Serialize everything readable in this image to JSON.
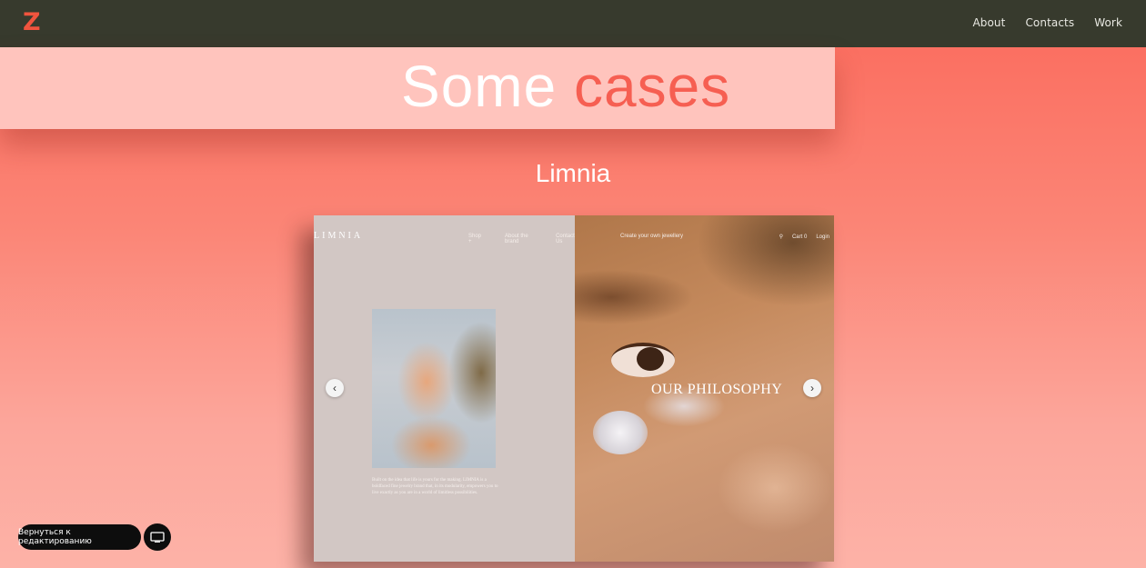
{
  "logo": "Z",
  "nav": {
    "items": [
      "About",
      "Contacts",
      "Work"
    ]
  },
  "heading": {
    "word1": "Some",
    "word2": "cases"
  },
  "case": {
    "title": "Limnia",
    "site": {
      "logo": "LIMNIA",
      "nav": [
        "Shop +",
        "About the brand",
        "Contact Us",
        "Create your own jewellery"
      ],
      "tools": [
        "Cart 0",
        "Login"
      ],
      "body_text": "Built on the idea that life is yours for the making. LIMNIA is a boldfaced fine jewelry brand that, in its modularity, empowers you to live exactly as you are in a world of limitless possibilities.",
      "slide_heading": "OUR PHILOSOPHY"
    }
  },
  "editor": {
    "back_label": "Вернуться к редактированию"
  },
  "colors": {
    "topbar": "#373a2d",
    "accent": "#f0543e",
    "strip": "#ffc4bd"
  },
  "icons": [
    "chevron-left-icon",
    "chevron-right-icon",
    "search-icon",
    "monitor-icon"
  ]
}
